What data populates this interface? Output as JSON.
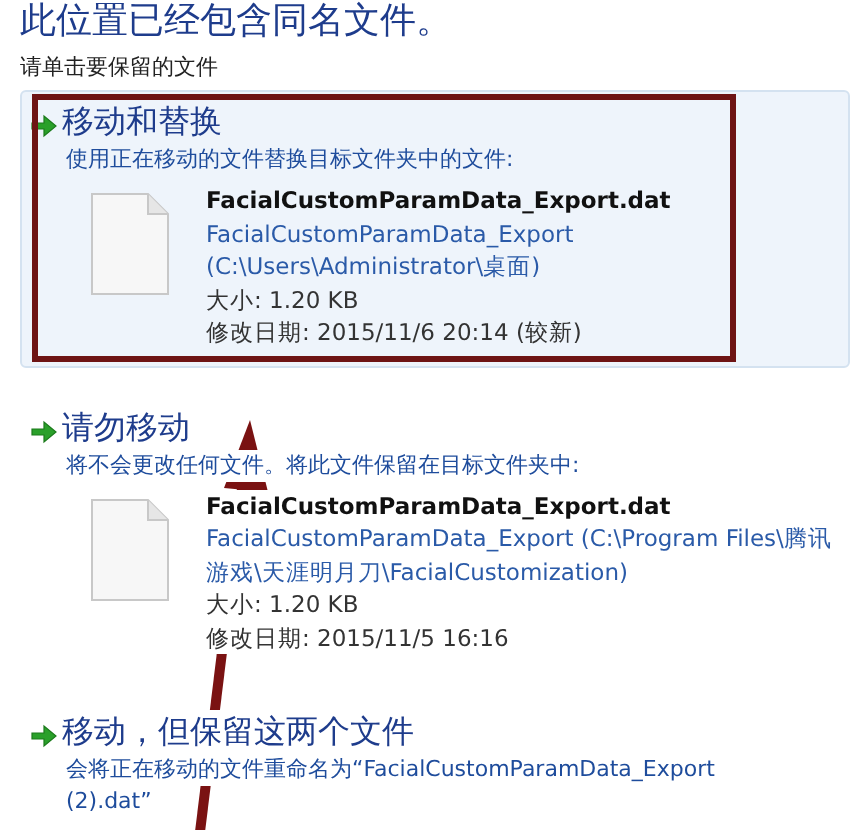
{
  "title": "此位置已经包含同名文件。",
  "subtitle": "请单击要保留的文件",
  "options": [
    {
      "heading": "移动和替换",
      "selected": true,
      "description_lines": [
        "使用正在移动的文件替换目标文件夹中的文件:"
      ],
      "file": {
        "name": "FacialCustomParamData_Export.dat",
        "path_lines": [
          "FacialCustomParamData_Export",
          "(C:\\Users\\Administrator\\桌面)"
        ],
        "size": "大小: 1.20 KB",
        "modified": "修改日期: 2015/11/6 20:14 (较新)"
      }
    },
    {
      "heading": "请勿移动",
      "selected": false,
      "description_lines": [
        "将不会更改任何文件。将此文件保留在目标文件夹中:"
      ],
      "file": {
        "name": "FacialCustomParamData_Export.dat",
        "path_lines": [
          "FacialCustomParamData_Export (C:\\Program Files\\腾讯",
          "游戏\\天涯明月刀\\FacialCustomization)"
        ],
        "size": "大小: 1.20 KB",
        "modified": "修改日期: 2015/11/5 16:16"
      }
    },
    {
      "heading": "移动，但保留这两个文件",
      "selected": false,
      "description_lines": [
        "会将正在移动的文件重命名为“FacialCustomParamData_Export",
        "(2).dat”"
      ]
    }
  ]
}
